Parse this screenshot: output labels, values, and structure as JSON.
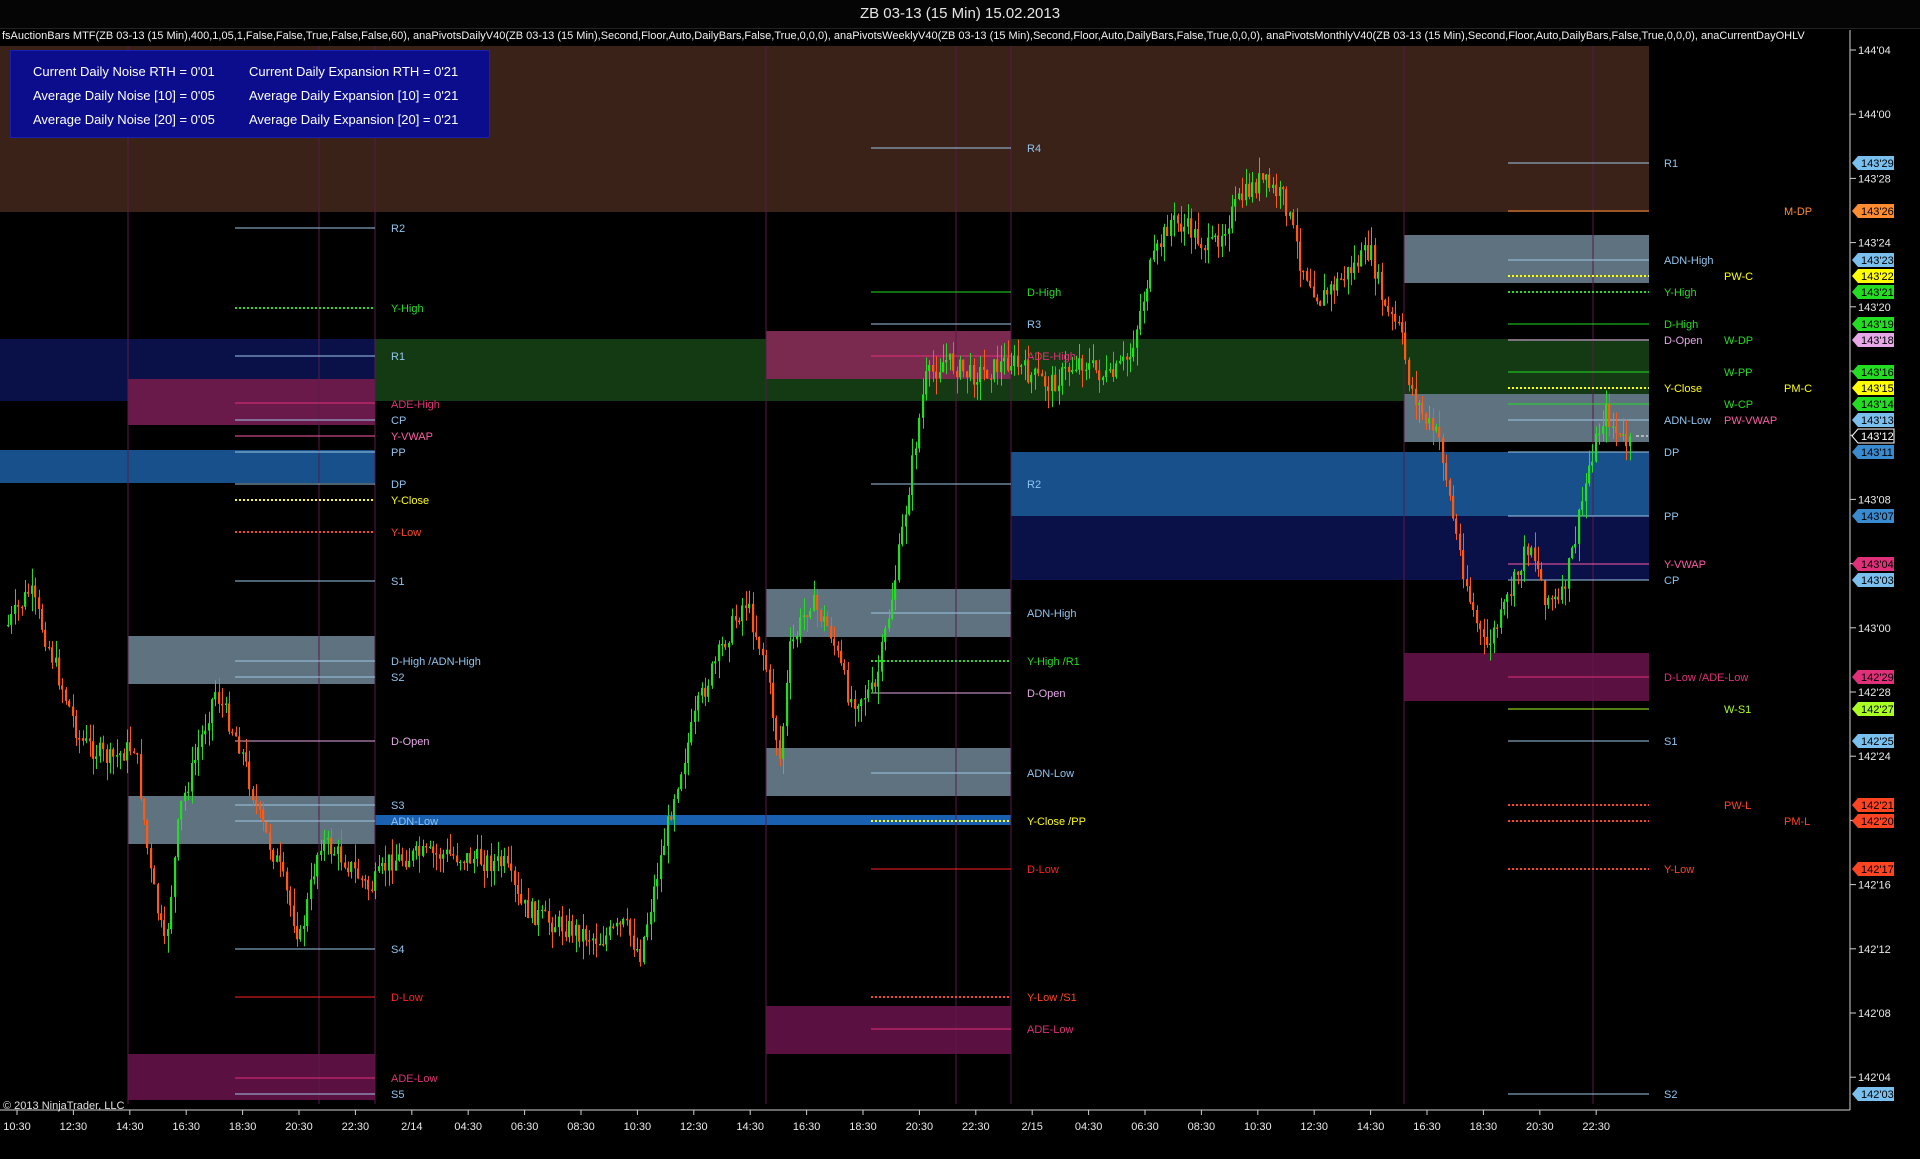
{
  "window": {
    "title": "ZB 03-13 (15 Min)  15.02.2013"
  },
  "indicator_line": "fsAuctionBars MTF(ZB 03-13 (15 Min),400,1,05,1,False,False,True,False,False,60), anaPivotsDailyV40(ZB 03-13 (15 Min),Second,Floor,Auto,DailyBars,False,True,0,0,0), anaPivotsWeeklyV40(ZB 03-13 (15 Min),Second,Floor,Auto,DailyBars,False,True,0,0,0), anaPivotsMonthlyV40(ZB 03-13 (15 Min),Second,Floor,Auto,DailyBars,False,True,0,0,0), anaCurrentDayOHLV",
  "stats": {
    "noise_rth": "Current Daily Noise RTH = 0'01",
    "noise_10": "Average Daily Noise [10] = 0'05",
    "noise_20": "Average Daily Noise [20] = 0'05",
    "expansion_rth": "Current Daily Expansion RTH = 0'21",
    "expansion_10": "Average Daily Expansion [10] = 0'21",
    "expansion_20": "Average Daily Expansion [20] = 0'21"
  },
  "copyright": "© 2013 NinjaTrader, LLC",
  "colors": {
    "up_candle": "#22dd22",
    "down_candle": "#ff5a14",
    "pivot_line": "#9ec8e6",
    "pivot_text": "#8fc4ee",
    "y_high": "#22dd22",
    "y_close": "#ffff00",
    "y_low": "#ff4422",
    "d_low": "#ff2222",
    "ade": "#e0307a",
    "d_open": "#e6a8e6",
    "monthly": "#ff8c30",
    "weekly": "#22dd22",
    "session_sep": "#5a1a4a"
  },
  "price_axis": {
    "ticks": [
      "144'04",
      "144'00",
      "143'28",
      "143'24",
      "143'20",
      "143'16",
      "143'12",
      "143'08",
      "143'04",
      "143'00",
      "142'28",
      "142'24",
      "142'20",
      "142'16",
      "142'12",
      "142'08",
      "142'04"
    ],
    "tags": [
      {
        "text": "143'29",
        "color": "#7ac0ee"
      },
      {
        "text": "143'26",
        "color": "#ff8c30"
      },
      {
        "text": "143'23",
        "color": "#7ac0ee"
      },
      {
        "text": "143'22",
        "color": "#ffff00"
      },
      {
        "text": "143'21",
        "color": "#22dd22"
      },
      {
        "text": "143'19",
        "color": "#22dd22"
      },
      {
        "text": "143'18",
        "color": "#e6a8e6"
      },
      {
        "text": "143'16",
        "color": "#22dd22"
      },
      {
        "text": "143'15",
        "color": "#ffff00"
      },
      {
        "text": "143'14",
        "color": "#22dd22"
      },
      {
        "text": "143'13",
        "color": "#7ac0ee"
      },
      {
        "text": "143'12",
        "color": "#000000"
      },
      {
        "text": "143'11",
        "color": "#3a8ad0"
      },
      {
        "text": "143'07",
        "color": "#3a8ad0"
      },
      {
        "text": "143'04",
        "color": "#e0307a"
      },
      {
        "text": "143'03",
        "color": "#7ac0ee"
      },
      {
        "text": "142'29",
        "color": "#e0307a"
      },
      {
        "text": "142'27",
        "color": "#aaff22"
      },
      {
        "text": "142'25",
        "color": "#7ac0ee"
      },
      {
        "text": "142'21",
        "color": "#ff4422"
      },
      {
        "text": "142'20",
        "color": "#ff4422"
      },
      {
        "text": "142'17",
        "color": "#ff4422"
      },
      {
        "text": "142'03",
        "color": "#7ac0ee"
      }
    ]
  },
  "time_axis": {
    "ticks": [
      "10:30",
      "12:30",
      "14:30",
      "16:30",
      "18:30",
      "20:30",
      "22:30",
      "2/14",
      "04:30",
      "06:30",
      "08:30",
      "10:30",
      "12:30",
      "14:30",
      "16:30",
      "18:30",
      "20:30",
      "22:30",
      "2/15",
      "04:30",
      "06:30",
      "08:30",
      "10:30",
      "12:30",
      "14:30",
      "16:30",
      "18:30",
      "20:30",
      "22:30"
    ]
  },
  "pivot_labels": {
    "s1": [
      {
        "text": "R2",
        "color": "#8fc4ee"
      },
      {
        "text": "Y-High",
        "color": "#22dd22"
      },
      {
        "text": "R1",
        "color": "#8fc4ee"
      },
      {
        "text": "ADE-High",
        "color": "#e0307a"
      },
      {
        "text": "CP",
        "color": "#8fc4ee"
      },
      {
        "text": "Y-VWAP",
        "color": "#ff5aa8"
      },
      {
        "text": "PP",
        "color": "#8fc4ee"
      },
      {
        "text": "DP",
        "color": "#8fc4ee"
      },
      {
        "text": "Y-Close",
        "color": "#ffff00"
      },
      {
        "text": "Y-Low",
        "color": "#ff4422"
      },
      {
        "text": "S1",
        "color": "#8fc4ee"
      },
      {
        "text": "D-High /ADN-High",
        "color": "#8fc4ee"
      },
      {
        "text": "S2",
        "color": "#8fc4ee"
      },
      {
        "text": "D-Open",
        "color": "#e6a8e6"
      },
      {
        "text": "S3",
        "color": "#8fc4ee"
      },
      {
        "text": "ADN-Low",
        "color": "#8fc4ee"
      },
      {
        "text": "S4",
        "color": "#8fc4ee"
      },
      {
        "text": "D-Low",
        "color": "#ff2222"
      },
      {
        "text": "ADE-Low",
        "color": "#e0307a"
      },
      {
        "text": "S5",
        "color": "#8fc4ee"
      }
    ],
    "s2": [
      {
        "text": "R4",
        "color": "#8fc4ee"
      },
      {
        "text": "D-High",
        "color": "#22dd22"
      },
      {
        "text": "R3",
        "color": "#8fc4ee"
      },
      {
        "text": "ADE-High",
        "color": "#e0307a"
      },
      {
        "text": "R2",
        "color": "#8fc4ee"
      },
      {
        "text": "ADN-High",
        "color": "#8fc4ee"
      },
      {
        "text": "Y-High /R1",
        "color": "#22dd22"
      },
      {
        "text": "D-Open",
        "color": "#e6a8e6"
      },
      {
        "text": "ADN-Low",
        "color": "#8fc4ee"
      },
      {
        "text": "Y-Close /PP",
        "color": "#ffff00"
      },
      {
        "text": "D-Low",
        "color": "#ff2222"
      },
      {
        "text": "Y-Low /S1",
        "color": "#ff4422"
      },
      {
        "text": "ADE-Low",
        "color": "#e0307a"
      }
    ],
    "s3": [
      {
        "text": "R1",
        "color": "#8fc4ee"
      },
      {
        "text": "M-DP",
        "color": "#ff8c30"
      },
      {
        "text": "ADN-High",
        "color": "#8fc4ee"
      },
      {
        "text": "PW-C",
        "color": "#ffff00"
      },
      {
        "text": "Y-High",
        "color": "#22dd22"
      },
      {
        "text": "D-High",
        "color": "#22dd22"
      },
      {
        "text": "D-Open",
        "color": "#e6a8e6"
      },
      {
        "text": "W-DP",
        "color": "#22dd22"
      },
      {
        "text": "W-PP",
        "color": "#22dd22"
      },
      {
        "text": "Y-Close",
        "color": "#ffff00"
      },
      {
        "text": "PM-C",
        "color": "#ffff00"
      },
      {
        "text": "W-CP",
        "color": "#22dd22"
      },
      {
        "text": "ADN-Low",
        "color": "#8fc4ee"
      },
      {
        "text": "PW-VWAP",
        "color": "#ff5aa8"
      },
      {
        "text": "DP",
        "color": "#8fc4ee"
      },
      {
        "text": "PP",
        "color": "#8fc4ee"
      },
      {
        "text": "Y-VWAP",
        "color": "#ff5aa8"
      },
      {
        "text": "CP",
        "color": "#8fc4ee"
      },
      {
        "text": "D-Low /ADE-Low",
        "color": "#e0307a"
      },
      {
        "text": "W-S1",
        "color": "#aaff22"
      },
      {
        "text": "S1",
        "color": "#8fc4ee"
      },
      {
        "text": "PW-L",
        "color": "#ff4422"
      },
      {
        "text": "PM-L",
        "color": "#ff4422"
      },
      {
        "text": "Y-Low",
        "color": "#ff4422"
      },
      {
        "text": "S2",
        "color": "#8fc4ee"
      }
    ]
  }
}
